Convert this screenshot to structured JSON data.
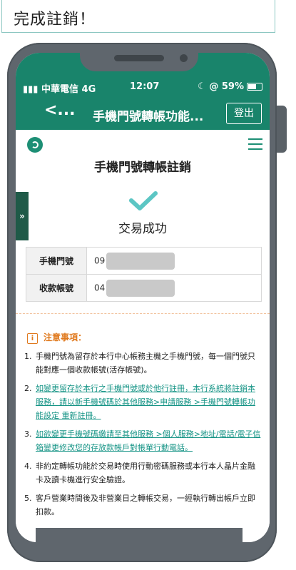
{
  "caption": "完成註銷！",
  "status_bar": {
    "carrier": "中華電信 4G",
    "time": "12:07",
    "battery": "59%"
  },
  "nav": {
    "back": "<...",
    "title": "手機門號轉帳功能...",
    "logout": "登出"
  },
  "page": {
    "title": "手機門號轉帳註銷",
    "success_text": "交易成功",
    "side_tab": "»"
  },
  "table": [
    {
      "label": "手機門號",
      "value": "09"
    },
    {
      "label": "收款帳號",
      "value": "04"
    }
  ],
  "notes": {
    "heading": "注意事項：",
    "icon_char": "i",
    "items": [
      {
        "num": "1.",
        "text": "手機門號為留存於本行中心帳務主機之手機門號，每一個門號只能對應一個收款帳號(活存帳號)。",
        "link": false
      },
      {
        "num": "2.",
        "text": "如變更留存於本行之手機門號或於他行註冊，本行系統將註銷本服務，請以新手機號碼於其他服務>申請服務 >手機門號轉帳功能設定 重新註冊。",
        "link": true
      },
      {
        "num": "3.",
        "text": "如欲變更手機號碼繳請至其他服務 >個人服務>地址/電話/電子信箱變更修改您的存放款帳戶對帳單行動電話。",
        "link": true
      },
      {
        "num": "4.",
        "text": "非約定轉帳功能於交易時使用行動密碼服務或本行本人晶片金融卡及讀卡機進行安全驗證。",
        "link": false
      },
      {
        "num": "5.",
        "text": "客戶營業時間後及非營業日之轉帳交易，一經執行轉出帳戶立即扣款。",
        "link": false
      }
    ]
  },
  "colors": {
    "header": "#19846b",
    "accent": "#1d8f75",
    "link": "#169486",
    "notice": "#e07a1f",
    "check": "#5cc6c4"
  }
}
